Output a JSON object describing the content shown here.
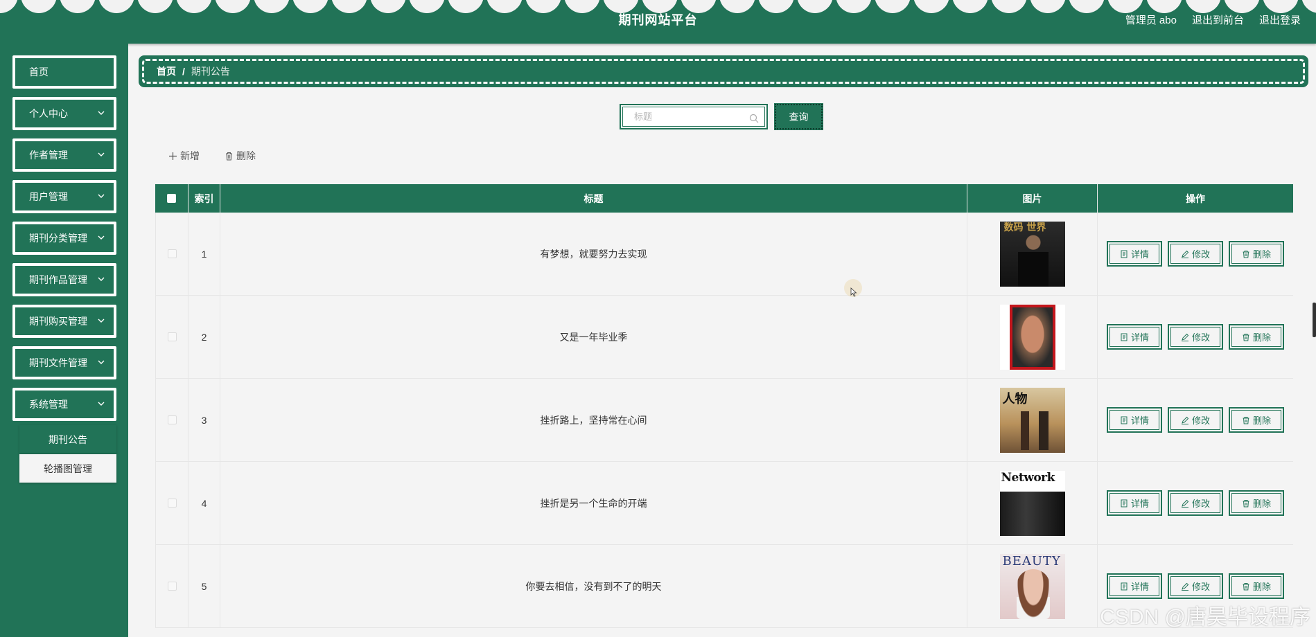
{
  "app": {
    "title": "期刊网站平台"
  },
  "header": {
    "user_label": "管理员 abo",
    "front_link": "退出到前台",
    "logout_link": "退出登录"
  },
  "sidebar": {
    "items": [
      {
        "label": "首页",
        "has_children": false
      },
      {
        "label": "个人中心",
        "has_children": true
      },
      {
        "label": "作者管理",
        "has_children": true
      },
      {
        "label": "用户管理",
        "has_children": true
      },
      {
        "label": "期刊分类管理",
        "has_children": true
      },
      {
        "label": "期刊作品管理",
        "has_children": true
      },
      {
        "label": "期刊购买管理",
        "has_children": true
      },
      {
        "label": "期刊文件管理",
        "has_children": true
      },
      {
        "label": "系统管理",
        "has_children": true,
        "expanded": true
      }
    ],
    "submenu": [
      {
        "label": "期刊公告",
        "active": true
      },
      {
        "label": "轮播图管理",
        "active": false
      }
    ]
  },
  "breadcrumb": {
    "home": "首页",
    "separator": "/",
    "current": "期刊公告"
  },
  "search": {
    "placeholder": "标题",
    "value": "",
    "button": "查询"
  },
  "actions": {
    "add": "新增",
    "delete": "删除"
  },
  "table": {
    "columns": [
      "",
      "索引",
      "标题",
      "图片",
      "操作"
    ],
    "rows": [
      {
        "index": "1",
        "title": "有梦想，就要努力去实现",
        "cover_text": "数码 世界"
      },
      {
        "index": "2",
        "title": "又是一年毕业季",
        "cover_text": ""
      },
      {
        "index": "3",
        "title": "挫折路上，坚持常在心间",
        "cover_text": "人物"
      },
      {
        "index": "4",
        "title": "挫折是另一个生命的开端",
        "cover_text": "Network"
      },
      {
        "index": "5",
        "title": "你要去相信，没有到不了的明天",
        "cover_text": "BEAUTY"
      }
    ],
    "row_actions": {
      "detail": "详情",
      "edit": "修改",
      "delete": "删除"
    }
  },
  "watermark": "CSDN @唐昊毕设程序",
  "colors": {
    "primary": "#217357",
    "background": "#f4f4f4",
    "header_scallop": "#f2f2f2"
  }
}
